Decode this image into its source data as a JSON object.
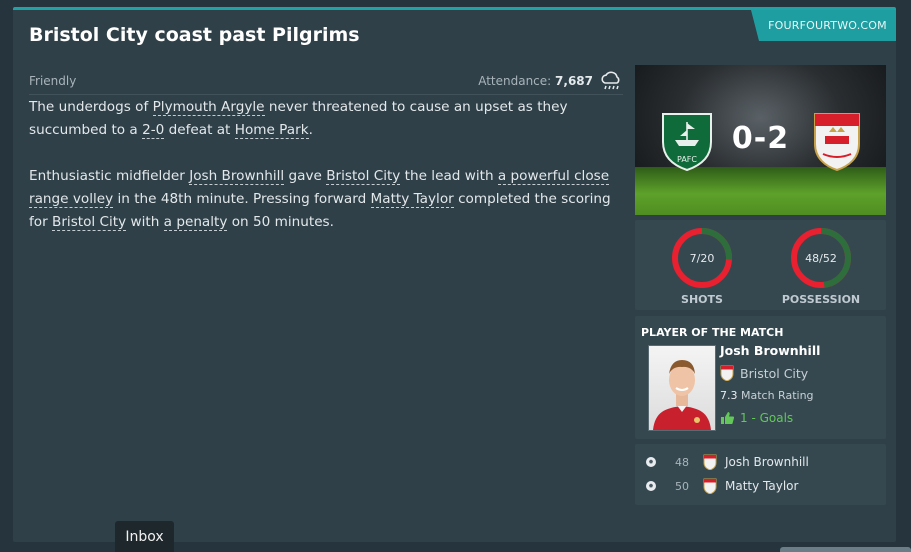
{
  "source": "FOURFOURTWO.COM",
  "headline": "Bristol City coast past Pilgrims",
  "meta": {
    "match_type": "Friendly",
    "attendance_label": "Attendance:",
    "attendance_value": "7,687",
    "weather_icon": "rain-cloud-icon"
  },
  "article": {
    "p1": {
      "t1": "The underdogs of ",
      "l1": "Plymouth Argyle",
      "t2": " never threatened to cause an upset as they succumbed to a ",
      "l2": "2-0",
      "t3": " defeat at ",
      "l3": "Home Park",
      "t4": "."
    },
    "p2": {
      "t1": "Enthusiastic midfielder ",
      "l1": "Josh Brownhill",
      "t2": " gave ",
      "l2": "Bristol City",
      "t3": " the lead with ",
      "l3": "a powerful close range volley",
      "t4": " in the 48th minute. Pressing forward ",
      "l4": "Matty Taylor",
      "t5": " completed the scoring for ",
      "l5": "Bristol City",
      "t6": " with ",
      "l6": "a penalty",
      "t7": " on 50 minutes."
    }
  },
  "scoreboard": {
    "score": "0-2",
    "home_crest": "plymouth-argyle-crest",
    "away_crest": "bristol-city-crest"
  },
  "stats": {
    "shots": {
      "value": "7/20",
      "label": "SHOTS",
      "home": 7,
      "away": 20
    },
    "possession": {
      "value": "48/52",
      "label": "POSSESSION",
      "home": 48,
      "away": 52
    },
    "colors": {
      "home": "#2d6e3c",
      "away": "#e8202f"
    }
  },
  "potm": {
    "title": "PLAYER OF THE MATCH",
    "name": "Josh Brownhill",
    "club": "Bristol City",
    "rating": "7.3",
    "rating_label": "Match Rating",
    "goals": "1 - Goals"
  },
  "goals": [
    {
      "minute": "48",
      "player": "Josh Brownhill"
    },
    {
      "minute": "50",
      "player": "Matty Taylor"
    }
  ],
  "bottom_tab": "Inbox",
  "colors": {
    "accent": "#1f9ea1",
    "panel": "#2f4048",
    "card": "#354850",
    "positive": "#63c75a"
  }
}
